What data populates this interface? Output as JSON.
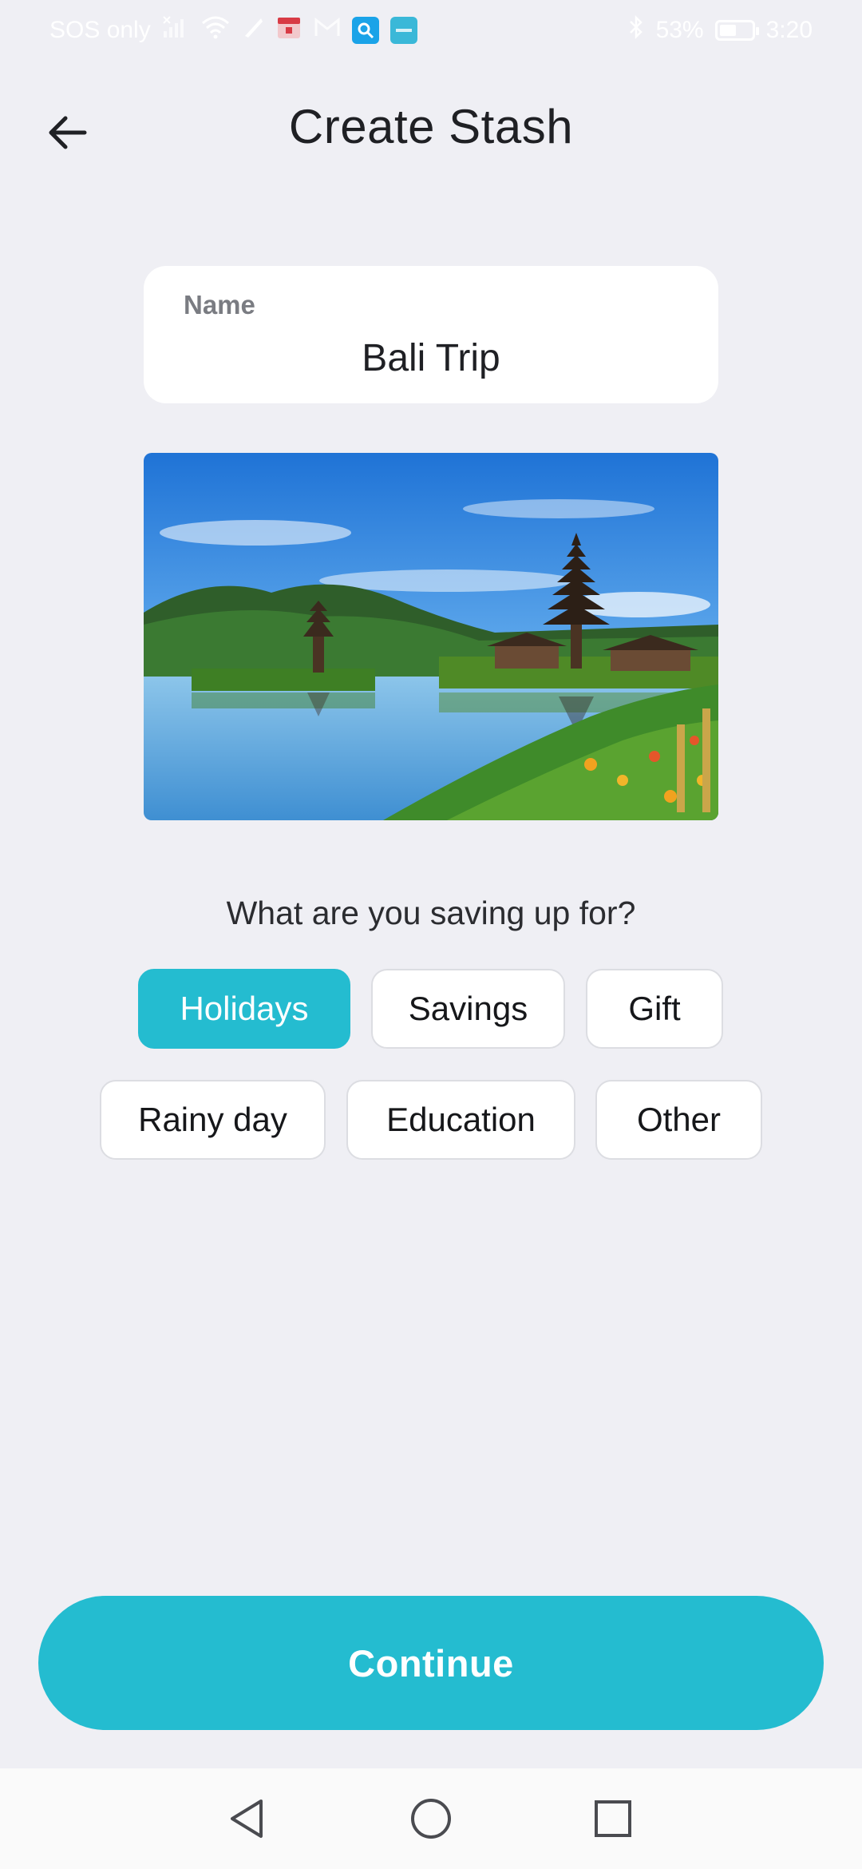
{
  "status_bar": {
    "carrier": "SOS only",
    "battery": "53%",
    "battery_level": 0.53,
    "time": "3:20",
    "icons": [
      "signal-icon",
      "wifi-icon",
      "slash-icon",
      "shop-app-icon",
      "gmail-icon",
      "search-app-icon",
      "blue-app-icon",
      "bluetooth-icon",
      "battery-icon"
    ]
  },
  "header": {
    "title": "Create Stash",
    "back_icon": "back-arrow-icon"
  },
  "name_field": {
    "label": "Name",
    "value": "Bali Trip"
  },
  "photo": {
    "description_icon": "stash-cover-photo"
  },
  "question": "What are you saving up for?",
  "categories": [
    {
      "label": "Holidays",
      "selected": true
    },
    {
      "label": "Savings",
      "selected": false
    },
    {
      "label": "Gift",
      "selected": false
    },
    {
      "label": "Rainy day",
      "selected": false
    },
    {
      "label": "Education",
      "selected": false
    },
    {
      "label": "Other",
      "selected": false
    }
  ],
  "continue_label": "Continue",
  "nav": {
    "back_icon": "nav-back-icon",
    "home_icon": "nav-home-icon",
    "recents_icon": "nav-recents-icon"
  },
  "colors": {
    "accent": "#24bcd0",
    "background": "#efeff4",
    "text": "#1f2024"
  }
}
